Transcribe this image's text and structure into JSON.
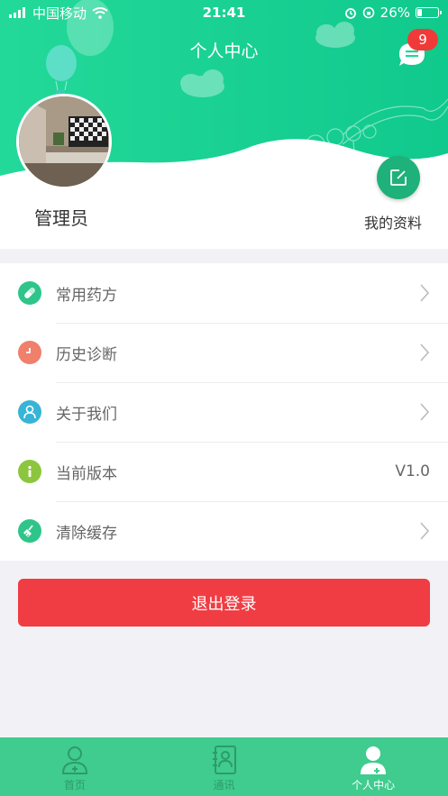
{
  "status_bar": {
    "carrier": "中国移动",
    "time": "21:41",
    "battery": "26%",
    "battery_level": 0.26
  },
  "header": {
    "title": "个人中心",
    "message_badge": "9",
    "username": "管理员",
    "profile_label": "我的资料"
  },
  "menu": {
    "items": [
      {
        "label": "常用药方",
        "icon": "pill-icon",
        "color": "#2ec58a"
      },
      {
        "label": "历史诊断",
        "icon": "clock-icon",
        "color": "#f07f6c"
      },
      {
        "label": "关于我们",
        "icon": "user-icon",
        "color": "#37b4d6"
      },
      {
        "label": "当前版本",
        "icon": "info-icon",
        "color": "#8cc63f",
        "value": "V1.0"
      },
      {
        "label": "清除缓存",
        "icon": "broom-icon",
        "color": "#2ec58a"
      }
    ]
  },
  "logout_label": "退出登录",
  "tabbar": {
    "tabs": [
      {
        "label": "首页",
        "icon": "doctor-icon",
        "active": false
      },
      {
        "label": "通讯",
        "icon": "contacts-icon",
        "active": false
      },
      {
        "label": "个人中心",
        "icon": "profile-icon",
        "active": true
      }
    ]
  },
  "colors": {
    "brand": "#1ed89a",
    "danger": "#f03d43",
    "tabbar": "#3fcc8e"
  }
}
